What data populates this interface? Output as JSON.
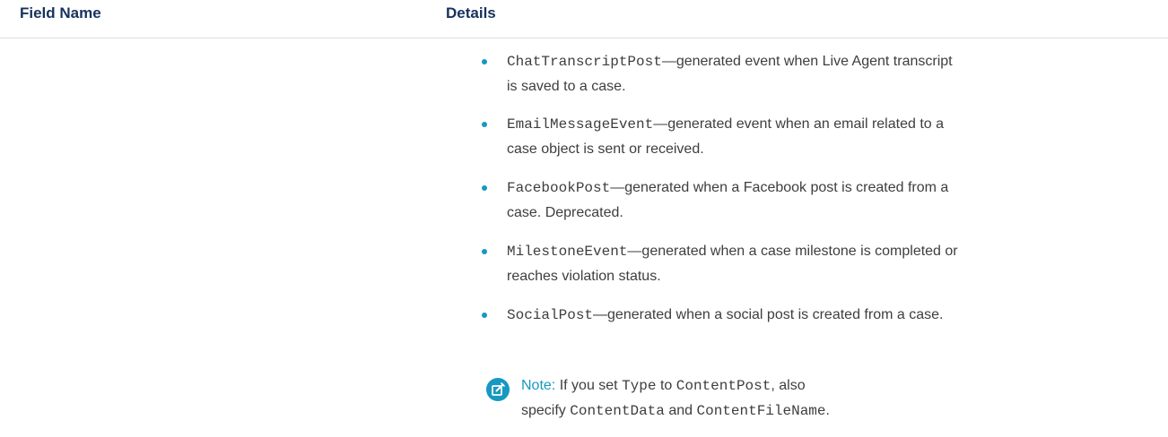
{
  "table": {
    "headers": {
      "field_name": "Field Name",
      "details": "Details"
    }
  },
  "details": {
    "bullets": [
      {
        "code": "ChatTranscriptPost",
        "line1": "—generated event when Live Agent transcript",
        "line2": "is saved to a case."
      },
      {
        "code": "EmailMessageEvent",
        "line1": "—generated event when an email related to a",
        "line2": "case object is sent or received."
      },
      {
        "code": "FacebookPost",
        "line1": "—generated when a Facebook post is created from a",
        "line2": "case. Deprecated."
      },
      {
        "code": "MilestoneEvent",
        "line1": "—generated when a case milestone is completed or",
        "line2": "reaches violation status."
      },
      {
        "code": "SocialPost",
        "line1": "—generated when a social post is created from a case.",
        "line2": ""
      }
    ],
    "note": {
      "icon": "edit-note-icon",
      "label": "Note:",
      "text1": "If you set",
      "code1": "Type",
      "text2": "to",
      "code2": "ContentPost",
      "text3": ", also",
      "text4": "specify",
      "code3": "ContentData",
      "text5": "and",
      "code4": "ContentFileName",
      "text6": "."
    },
    "accent_color": "#1798c1",
    "header_color": "#16325c"
  }
}
